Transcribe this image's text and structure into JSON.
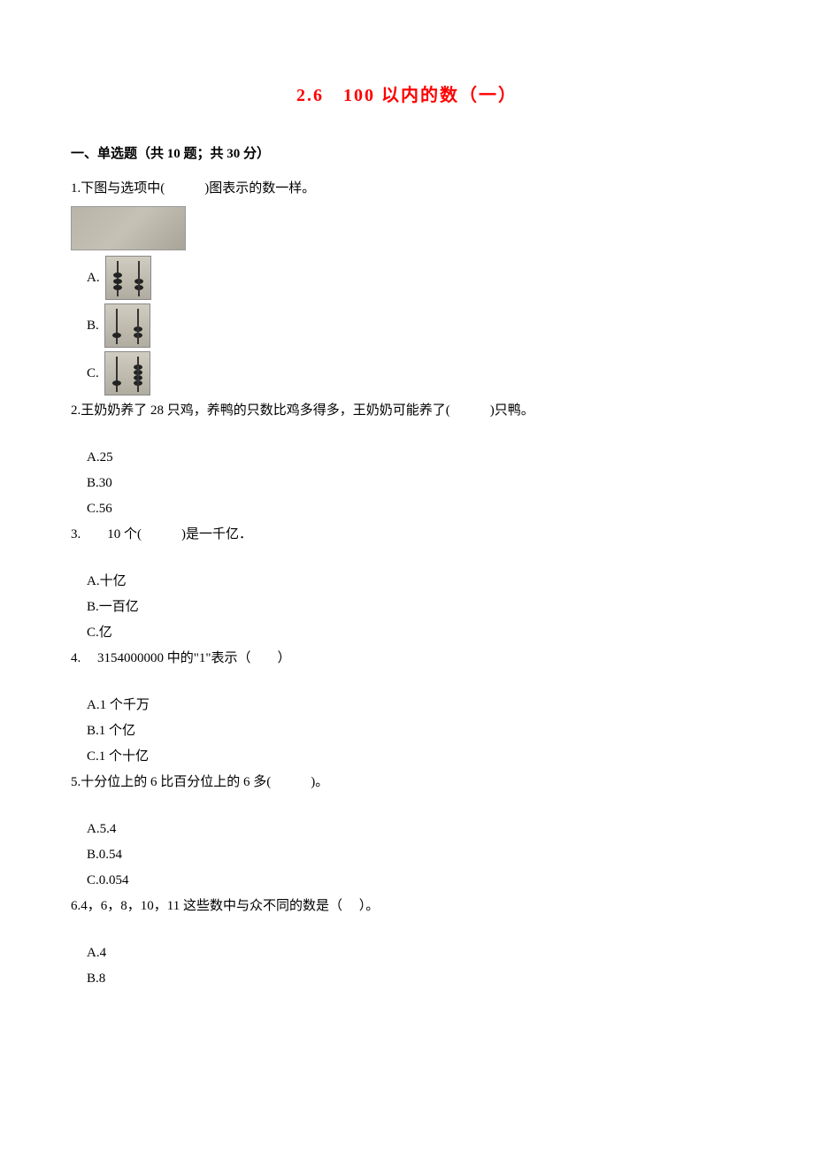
{
  "title": "2.6　100 以内的数（一）",
  "section1": {
    "header": "一、单选题（共 10 题；共 30 分）",
    "q1": {
      "text": "1.下图与选项中(　　　)图表示的数一样。",
      "optA": "A.",
      "optB": "B.",
      "optC": "C."
    },
    "q2": {
      "text": "2.王奶奶养了 28 只鸡，养鸭的只数比鸡多得多，王奶奶可能养了(　　　)只鸭。",
      "optA": "A.25",
      "optB": "B.30",
      "optC": "C.56"
    },
    "q3": {
      "text": "3.　　10 个(　　　)是一千亿．",
      "optA": "A.十亿",
      "optB": "B.一百亿",
      "optC": "C.亿"
    },
    "q4": {
      "text": "4.　 3154000000 中的\"1\"表示（　　）",
      "optA": "A.1 个千万",
      "optB": "B.1 个亿",
      "optC": "C.1 个十亿"
    },
    "q5": {
      "text": "5.十分位上的 6 比百分位上的 6 多(　　　)。",
      "optA": "A.5.4",
      "optB": "B.0.54",
      "optC": "C.0.054"
    },
    "q6": {
      "text": "6.4，6，8，10，11 这些数中与众不同的数是（　 ）。",
      "optA": "A.4",
      "optB": "B.8"
    }
  }
}
